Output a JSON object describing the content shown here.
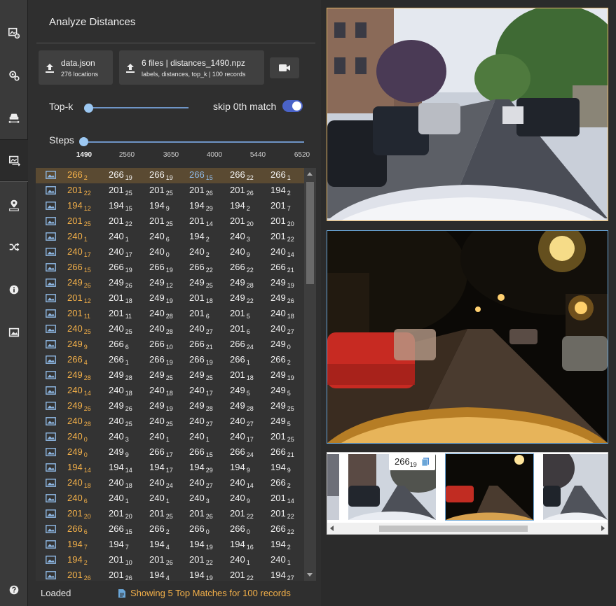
{
  "panel": {
    "title": "Analyze Distances"
  },
  "uploads": [
    {
      "title": "data.json",
      "subtitle": "276 locations"
    },
    {
      "title": "6 files | distances_1490.npz",
      "subtitle": "labels, distances, top_k | 100 records"
    }
  ],
  "controls": {
    "topk_label": "Top-k",
    "skip_label": "skip 0th match",
    "skip_on": true,
    "steps_label": "Steps",
    "steps_ticks": [
      "1490",
      "2560",
      "3650",
      "4000",
      "5440",
      "6520"
    ],
    "steps_value": "1490"
  },
  "rows": [
    [
      [
        "266",
        "2"
      ],
      [
        "266",
        "19"
      ],
      [
        "266",
        "19"
      ],
      [
        "266",
        "15"
      ],
      [
        "266",
        "22"
      ],
      [
        "266",
        "1"
      ]
    ],
    [
      [
        "201",
        "22"
      ],
      [
        "201",
        "25"
      ],
      [
        "201",
        "25"
      ],
      [
        "201",
        "26"
      ],
      [
        "201",
        "26"
      ],
      [
        "194",
        "2"
      ]
    ],
    [
      [
        "194",
        "12"
      ],
      [
        "194",
        "15"
      ],
      [
        "194",
        "9"
      ],
      [
        "194",
        "29"
      ],
      [
        "194",
        "2"
      ],
      [
        "201",
        "7"
      ]
    ],
    [
      [
        "201",
        "25"
      ],
      [
        "201",
        "22"
      ],
      [
        "201",
        "25"
      ],
      [
        "201",
        "14"
      ],
      [
        "201",
        "20"
      ],
      [
        "201",
        "20"
      ]
    ],
    [
      [
        "240",
        "1"
      ],
      [
        "240",
        "1"
      ],
      [
        "240",
        "6"
      ],
      [
        "194",
        "2"
      ],
      [
        "240",
        "3"
      ],
      [
        "201",
        "22"
      ]
    ],
    [
      [
        "240",
        "17"
      ],
      [
        "240",
        "17"
      ],
      [
        "240",
        "0"
      ],
      [
        "240",
        "2"
      ],
      [
        "240",
        "9"
      ],
      [
        "240",
        "14"
      ]
    ],
    [
      [
        "266",
        "15"
      ],
      [
        "266",
        "19"
      ],
      [
        "266",
        "19"
      ],
      [
        "266",
        "22"
      ],
      [
        "266",
        "22"
      ],
      [
        "266",
        "21"
      ]
    ],
    [
      [
        "249",
        "26"
      ],
      [
        "249",
        "26"
      ],
      [
        "249",
        "12"
      ],
      [
        "249",
        "25"
      ],
      [
        "249",
        "28"
      ],
      [
        "249",
        "19"
      ]
    ],
    [
      [
        "201",
        "12"
      ],
      [
        "201",
        "18"
      ],
      [
        "249",
        "19"
      ],
      [
        "201",
        "18"
      ],
      [
        "249",
        "22"
      ],
      [
        "249",
        "26"
      ]
    ],
    [
      [
        "201",
        "11"
      ],
      [
        "201",
        "11"
      ],
      [
        "240",
        "28"
      ],
      [
        "201",
        "6"
      ],
      [
        "201",
        "5"
      ],
      [
        "240",
        "18"
      ]
    ],
    [
      [
        "240",
        "25"
      ],
      [
        "240",
        "25"
      ],
      [
        "240",
        "28"
      ],
      [
        "240",
        "27"
      ],
      [
        "201",
        "6"
      ],
      [
        "240",
        "27"
      ]
    ],
    [
      [
        "249",
        "9"
      ],
      [
        "266",
        "6"
      ],
      [
        "266",
        "10"
      ],
      [
        "266",
        "21"
      ],
      [
        "266",
        "24"
      ],
      [
        "249",
        "0"
      ]
    ],
    [
      [
        "266",
        "4"
      ],
      [
        "266",
        "1"
      ],
      [
        "266",
        "19"
      ],
      [
        "266",
        "19"
      ],
      [
        "266",
        "1"
      ],
      [
        "266",
        "2"
      ]
    ],
    [
      [
        "249",
        "28"
      ],
      [
        "249",
        "28"
      ],
      [
        "249",
        "25"
      ],
      [
        "249",
        "25"
      ],
      [
        "201",
        "18"
      ],
      [
        "249",
        "19"
      ]
    ],
    [
      [
        "240",
        "14"
      ],
      [
        "240",
        "18"
      ],
      [
        "240",
        "18"
      ],
      [
        "240",
        "17"
      ],
      [
        "249",
        "5"
      ],
      [
        "249",
        "5"
      ]
    ],
    [
      [
        "249",
        "26"
      ],
      [
        "249",
        "26"
      ],
      [
        "249",
        "19"
      ],
      [
        "249",
        "28"
      ],
      [
        "249",
        "28"
      ],
      [
        "249",
        "25"
      ]
    ],
    [
      [
        "240",
        "28"
      ],
      [
        "240",
        "25"
      ],
      [
        "240",
        "25"
      ],
      [
        "240",
        "27"
      ],
      [
        "240",
        "27"
      ],
      [
        "249",
        "5"
      ]
    ],
    [
      [
        "240",
        "0"
      ],
      [
        "240",
        "3"
      ],
      [
        "240",
        "1"
      ],
      [
        "240",
        "1"
      ],
      [
        "240",
        "17"
      ],
      [
        "201",
        "25"
      ]
    ],
    [
      [
        "249",
        "0"
      ],
      [
        "249",
        "9"
      ],
      [
        "266",
        "17"
      ],
      [
        "266",
        "15"
      ],
      [
        "266",
        "24"
      ],
      [
        "266",
        "21"
      ]
    ],
    [
      [
        "194",
        "14"
      ],
      [
        "194",
        "14"
      ],
      [
        "194",
        "17"
      ],
      [
        "194",
        "29"
      ],
      [
        "194",
        "9"
      ],
      [
        "194",
        "9"
      ]
    ],
    [
      [
        "240",
        "18"
      ],
      [
        "240",
        "18"
      ],
      [
        "240",
        "24"
      ],
      [
        "240",
        "27"
      ],
      [
        "240",
        "14"
      ],
      [
        "266",
        "2"
      ]
    ],
    [
      [
        "240",
        "6"
      ],
      [
        "240",
        "1"
      ],
      [
        "240",
        "1"
      ],
      [
        "240",
        "3"
      ],
      [
        "240",
        "9"
      ],
      [
        "201",
        "14"
      ]
    ],
    [
      [
        "201",
        "20"
      ],
      [
        "201",
        "20"
      ],
      [
        "201",
        "25"
      ],
      [
        "201",
        "26"
      ],
      [
        "201",
        "22"
      ],
      [
        "201",
        "22"
      ]
    ],
    [
      [
        "266",
        "6"
      ],
      [
        "266",
        "15"
      ],
      [
        "266",
        "2"
      ],
      [
        "266",
        "0"
      ],
      [
        "266",
        "0"
      ],
      [
        "266",
        "22"
      ]
    ],
    [
      [
        "194",
        "7"
      ],
      [
        "194",
        "7"
      ],
      [
        "194",
        "4"
      ],
      [
        "194",
        "19"
      ],
      [
        "194",
        "16"
      ],
      [
        "194",
        "2"
      ]
    ],
    [
      [
        "194",
        "2"
      ],
      [
        "201",
        "10"
      ],
      [
        "201",
        "26"
      ],
      [
        "201",
        "22"
      ],
      [
        "240",
        "1"
      ],
      [
        "240",
        "1"
      ]
    ],
    [
      [
        "201",
        "26"
      ],
      [
        "201",
        "26"
      ],
      [
        "194",
        "4"
      ],
      [
        "194",
        "19"
      ],
      [
        "201",
        "22"
      ],
      [
        "194",
        "27"
      ]
    ]
  ],
  "status": {
    "state": "Loaded",
    "message": "Showing 5 Top Matches for 100 records"
  },
  "tooltip": {
    "value": "266",
    "sub": "19"
  },
  "colors": {
    "query": "#f3b049",
    "highlight": "#8fb9e6",
    "accent": "#4a63c8"
  },
  "icons": [
    "settings-map-icon",
    "settings-route-icon",
    "car-distance-icon",
    "image-compare-icon",
    "location-measure-icon",
    "shuffle-icon",
    "info-icon",
    "image-icon",
    "help-icon",
    "upload-icon",
    "video-camera-icon",
    "copy-icon"
  ]
}
